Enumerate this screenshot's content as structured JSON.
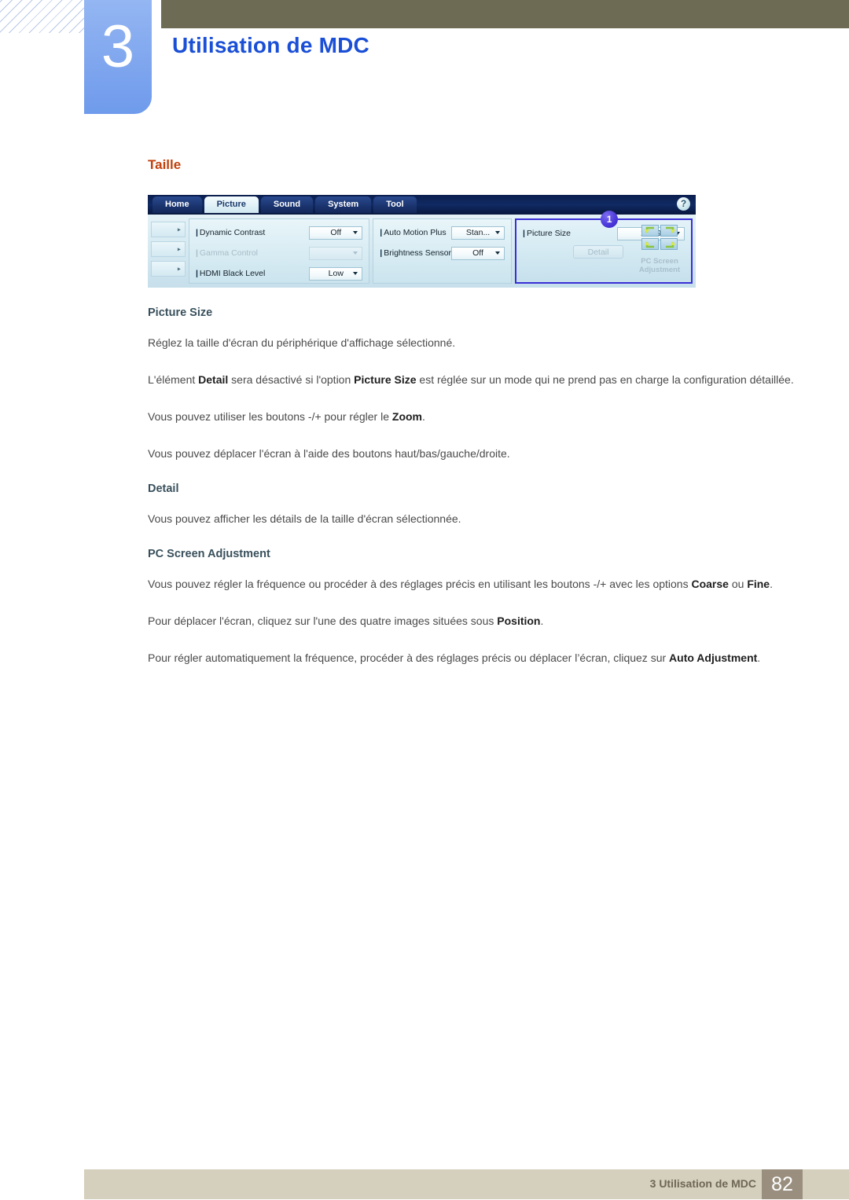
{
  "header": {
    "chapter_number": "3",
    "chapter_title": "Utilisation de MDC",
    "bar_color": "#6e6b55",
    "tab_color": "#83a9ef",
    "title_color": "#1a4fd6"
  },
  "section": {
    "title": "Taille",
    "title_color": "#c1410d"
  },
  "mdc": {
    "tabs": [
      {
        "label": "Home",
        "active": false
      },
      {
        "label": "Picture",
        "active": true
      },
      {
        "label": "Sound",
        "active": false
      },
      {
        "label": "System",
        "active": false
      },
      {
        "label": "Tool",
        "active": false
      }
    ],
    "help_label": "?",
    "rail": [
      {
        "arrow": "▸"
      },
      {
        "arrow": "▸"
      },
      {
        "arrow": "▸"
      }
    ],
    "panel_a": [
      {
        "label": "Dynamic Contrast",
        "value": "Off",
        "disabled": false
      },
      {
        "label": "Gamma Control",
        "value": "",
        "disabled": true
      },
      {
        "label": "HDMI Black Level",
        "value": "Low",
        "disabled": false
      }
    ],
    "panel_b": [
      {
        "label": "Auto Motion Plus",
        "value": "Stan...",
        "disabled": false
      },
      {
        "label": "Brightness Sensor",
        "value": "Off",
        "disabled": false
      }
    ],
    "panel_c": {
      "label": "Picture Size",
      "value": "16 : 9",
      "detail_label": "Detail",
      "pc_screen_label_line1": "PC Screen",
      "pc_screen_label_line2": "Adjustment",
      "badge": "1",
      "highlight_color": "#3a2fd6"
    }
  },
  "body": {
    "h_picture_size": "Picture Size",
    "p1": "Réglez la taille d'écran du périphérique d'affichage sélectionné.",
    "p2_a": "L'élément ",
    "p2_b": "Detail",
    "p2_c": " sera désactivé si l'option ",
    "p2_d": "Picture Size",
    "p2_e": " est réglée sur un mode qui ne prend pas en charge la configuration détaillée.",
    "p3_a": "Vous pouvez utiliser les boutons -/+ pour régler le ",
    "p3_b": "Zoom",
    "p3_c": ".",
    "p4": "Vous pouvez déplacer l'écran à l'aide des boutons haut/bas/gauche/droite.",
    "h_detail": "Detail",
    "p5": "Vous pouvez afficher les détails de la taille d'écran sélectionnée.",
    "h_pc_screen": "PC Screen Adjustment",
    "p6_a": "Vous pouvez régler la fréquence ou procéder à des réglages précis en utilisant les boutons -/+ avec les options ",
    "p6_b": "Coarse",
    "p6_c": " ou ",
    "p6_d": "Fine",
    "p6_e": ".",
    "p7_a": "Pour déplacer l'écran, cliquez sur l'une des quatre images situées sous ",
    "p7_b": "Position",
    "p7_c": ".",
    "p8_a": "Pour régler automatiquement la fréquence, procéder à des réglages précis ou déplacer l’écran, cliquez sur ",
    "p8_b": "Auto Adjustment",
    "p8_c": "."
  },
  "footer": {
    "text": "3 Utilisation de MDC",
    "page": "82",
    "bar_color": "#d5cfbd",
    "page_box_color": "#9a8f7f"
  }
}
